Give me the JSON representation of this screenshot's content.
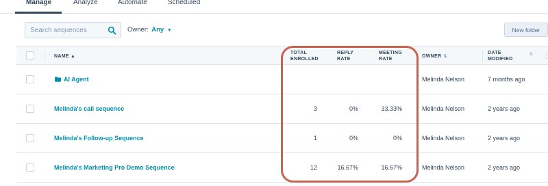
{
  "tabs": [
    {
      "label": "Manage",
      "active": true
    },
    {
      "label": "Analyze",
      "active": false
    },
    {
      "label": "Automate",
      "active": false
    },
    {
      "label": "Scheduled",
      "active": false
    }
  ],
  "toolbar": {
    "search_placeholder": "Search sequences",
    "owner_label": "Owner:",
    "owner_value": "Any",
    "new_folder_label": "New folder"
  },
  "table": {
    "headers": {
      "name": "NAME",
      "total_enrolled_1": "TOTAL",
      "total_enrolled_2": "ENROLLED",
      "reply_rate_1": "REPLY",
      "reply_rate_2": "RATE",
      "meeting_rate_1": "MEETING",
      "meeting_rate_2": "RATE",
      "owner": "OWNER",
      "date_modified_1": "DATE",
      "date_modified_2": "MODIFIED"
    },
    "rows": [
      {
        "name": "AI Agent",
        "is_folder": true,
        "total_enrolled": "",
        "reply_rate": "",
        "meeting_rate": "",
        "owner": "Melinda Nelson",
        "date_modified": "7 months ago"
      },
      {
        "name": "Melinda's call sequence",
        "is_folder": false,
        "total_enrolled": "3",
        "reply_rate": "0%",
        "meeting_rate": "33.33%",
        "owner": "Melinda Nelson",
        "date_modified": "2 years ago"
      },
      {
        "name": "Melinda's Follow-up Sequence",
        "is_folder": false,
        "total_enrolled": "1",
        "reply_rate": "0%",
        "meeting_rate": "0%",
        "owner": "Melinda Nelson",
        "date_modified": "2 years ago"
      },
      {
        "name": "Melinda's Marketing Pro Demo Sequence",
        "is_folder": false,
        "total_enrolled": "12",
        "reply_rate": "16.67%",
        "meeting_rate": "16.67%",
        "owner": "Melinda Nelson",
        "date_modified": "2 years ago"
      }
    ]
  },
  "colors": {
    "accent_link": "#0091ae",
    "highlight_ring": "#c8634f",
    "header_bg": "#f5f8fa"
  }
}
